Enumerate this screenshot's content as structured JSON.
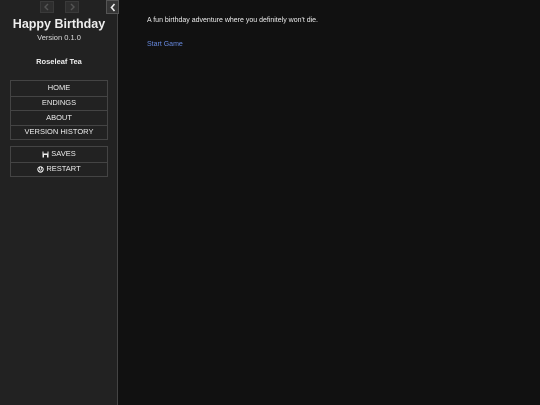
{
  "sidebar": {
    "title": "Happy Birthday",
    "version": "Version 0.1.0",
    "author": "Roseleaf Tea",
    "story_menu": [
      {
        "label": "HOME"
      },
      {
        "label": "ENDINGS"
      },
      {
        "label": "ABOUT"
      },
      {
        "label": "VERSION HISTORY"
      }
    ],
    "core_menu": [
      {
        "label": "SAVES",
        "icon": "save-icon"
      },
      {
        "label": "RESTART",
        "icon": "restart-icon"
      }
    ]
  },
  "passage": {
    "text": "A fun birthday adventure where you definitely won't die.",
    "link_label": "Start Game"
  },
  "colors": {
    "background": "#111111",
    "sidebar": "#222222",
    "link": "#6688dd"
  }
}
